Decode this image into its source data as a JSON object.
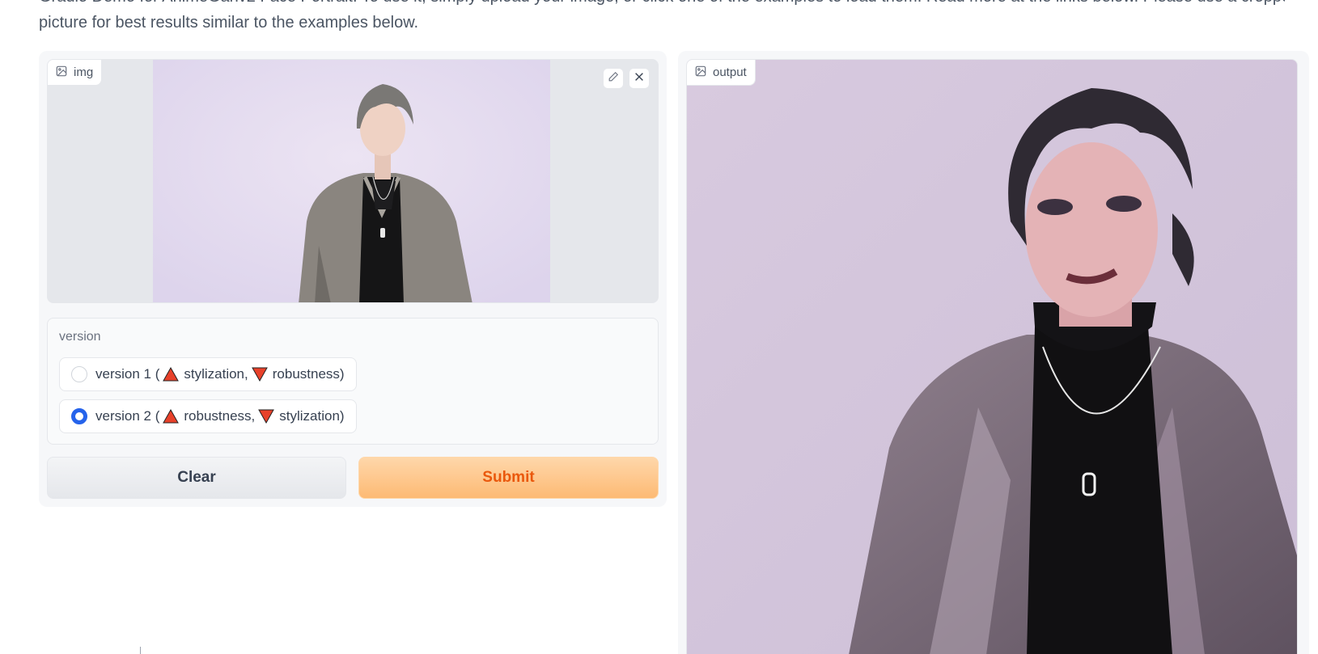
{
  "description": {
    "line1": "Gradio Demo for AnimeGanv2 Face Portrait. To use it, simply upload your image, or click one of the examples to load them. Read more at the links below. Please use a cropped portrait",
    "line2": "picture for best results similar to the examples below."
  },
  "input_image": {
    "label": "img",
    "label_icon": "image-icon",
    "tools": [
      "pencil-icon",
      "close-icon"
    ]
  },
  "version": {
    "title": "version",
    "options": [
      {
        "prefix": "version 1 (",
        "first": "stylization,",
        "second": "robustness)",
        "first_icon": "triangle-up-icon",
        "second_icon": "triangle-down-icon",
        "selected": false
      },
      {
        "prefix": "version 2 (",
        "first": "robustness,",
        "second": "stylization)",
        "first_icon": "triangle-up-icon",
        "second_icon": "triangle-down-icon",
        "selected": true
      }
    ]
  },
  "buttons": {
    "clear": "Clear",
    "submit": "Submit"
  },
  "output_image": {
    "label": "output",
    "label_icon": "image-icon"
  },
  "colors": {
    "accent": "#2563eb",
    "submit_text": "#ea580c",
    "submit_bg": "#fdba74",
    "triangle": "#e8412a"
  }
}
